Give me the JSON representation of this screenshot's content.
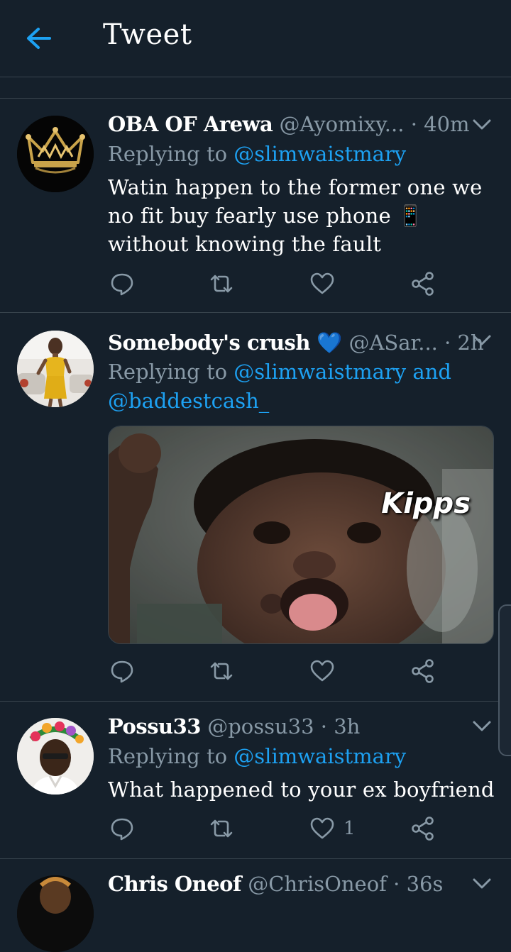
{
  "header": {
    "title": "Tweet",
    "back_icon": "arrow-left-icon",
    "accent": "#1da1f2"
  },
  "tweets": [
    {
      "display_name": "OBA OF Arewa",
      "badge": "",
      "handle": "@Ayomixy...",
      "separator": "·",
      "time": "40m",
      "replying_prefix": "Replying to",
      "mentions": [
        "@slimwaistmary"
      ],
      "text_parts": [
        "Watin happen to the former one we no fit buy fearly use phone",
        "📱",
        "without knowing the fault"
      ],
      "like_count": ""
    },
    {
      "display_name": "Somebody's crush",
      "badge": "💙",
      "handle": "@ASar...",
      "separator": "·",
      "time": "2h",
      "replying_prefix": "Replying to",
      "mentions": [
        "@slimwaistmary",
        "and",
        "@baddestcash_"
      ],
      "media_caption": "Kipps",
      "like_count": ""
    },
    {
      "display_name": "Possu33",
      "handle": "@possu33",
      "separator": "·",
      "time": "3h",
      "replying_prefix": "Replying to",
      "mentions": [
        "@slimwaistmary"
      ],
      "text": "What happened to your ex boyfriend",
      "like_count": "1"
    },
    {
      "display_name": "Chris Oneof",
      "handle": "@ChrisOneof",
      "separator": "·",
      "time": "36s"
    }
  ],
  "icons": [
    "reply-icon",
    "retweet-icon",
    "like-icon",
    "share-icon",
    "chevron-down-icon"
  ],
  "colors": {
    "background": "#15202b",
    "secondary_text": "#8899a6",
    "divider": "#38444d",
    "link": "#1da1f2"
  }
}
